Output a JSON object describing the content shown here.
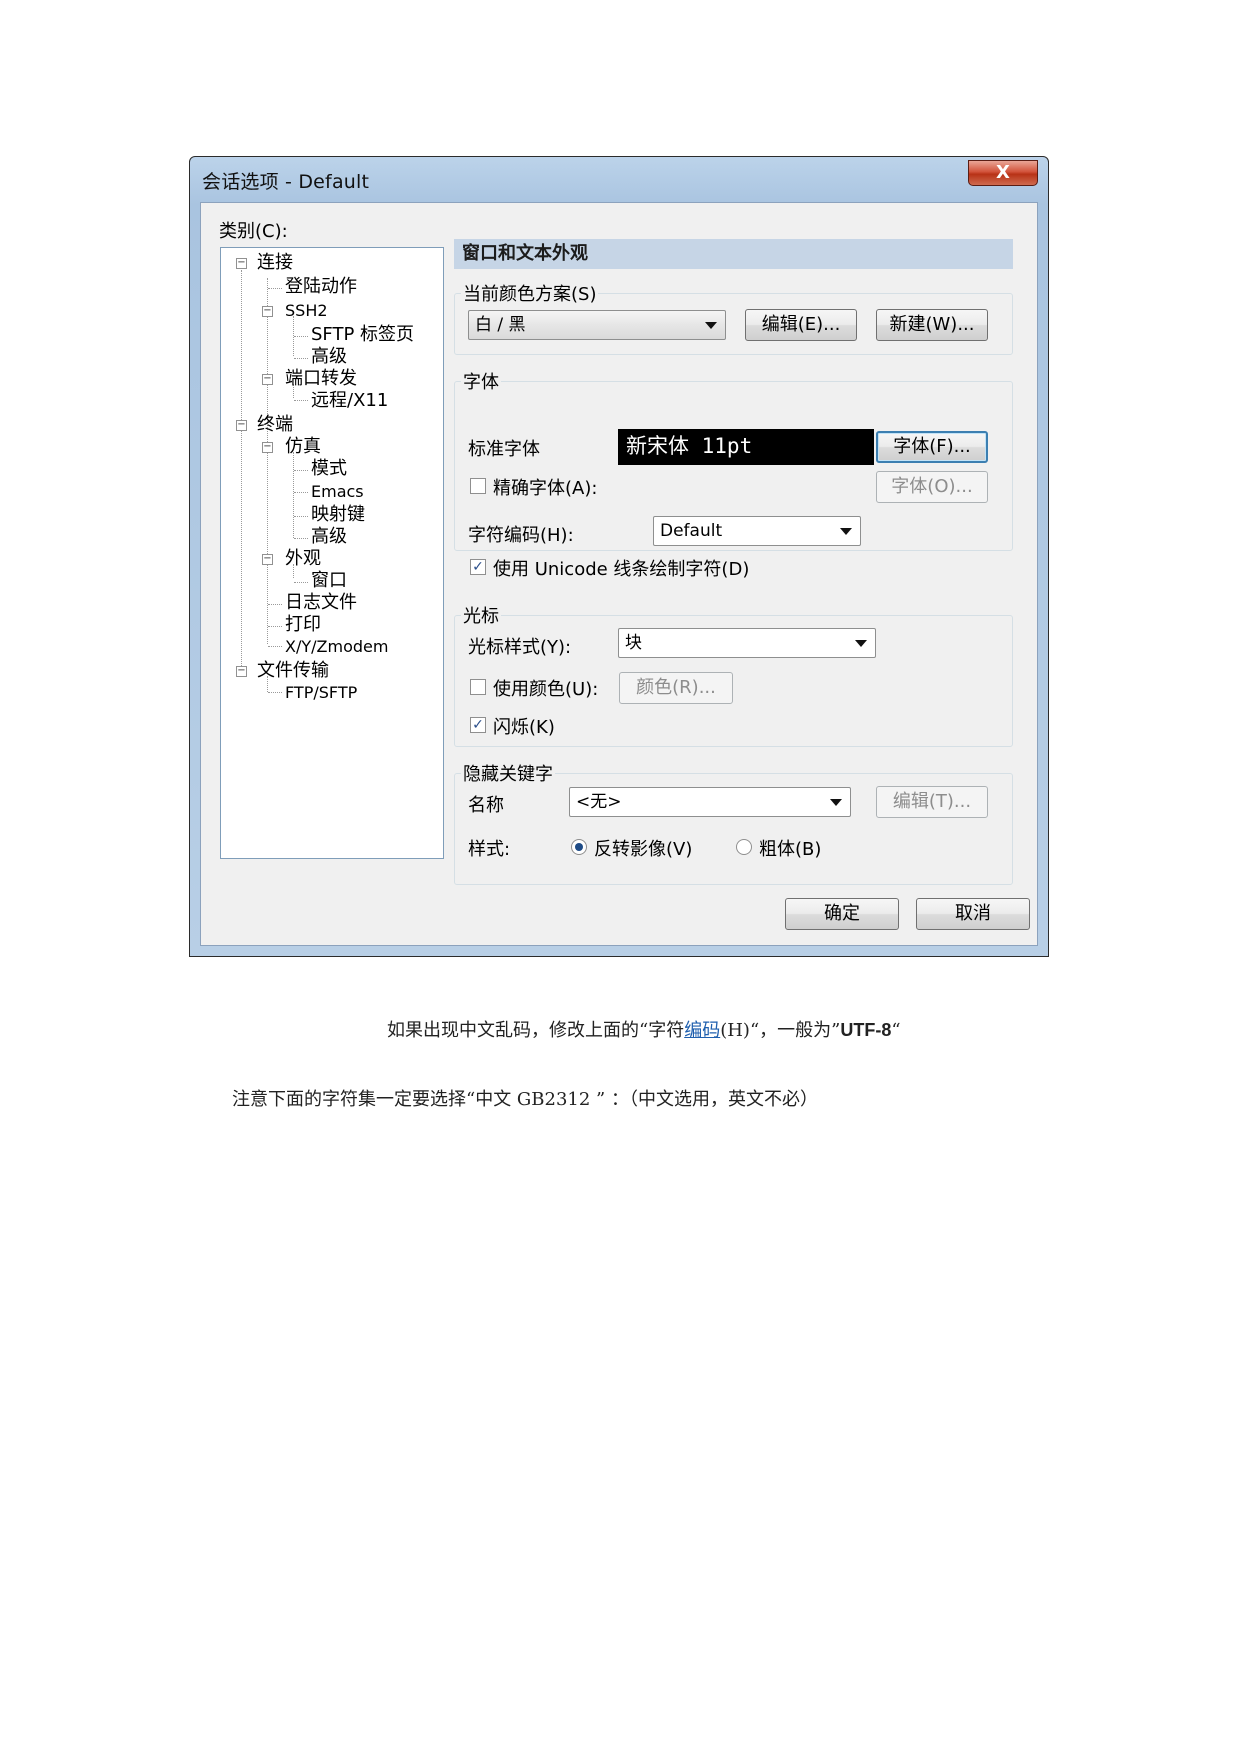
{
  "dialog": {
    "title": "会话选项 - Default",
    "close_label": "X",
    "category_label": "类别(C):",
    "tree": [
      {
        "label": "连接",
        "level": 0,
        "expanded": true
      },
      {
        "label": "登陆动作",
        "level": 1
      },
      {
        "label": "SSH2",
        "level": 1,
        "expanded": true
      },
      {
        "label": "SFTP 标签页",
        "level": 2
      },
      {
        "label": "高级",
        "level": 2
      },
      {
        "label": "端口转发",
        "level": 1,
        "expanded": true
      },
      {
        "label": "远程/X11",
        "level": 2
      },
      {
        "label": "终端",
        "level": 0,
        "expanded": true
      },
      {
        "label": "仿真",
        "level": 1,
        "expanded": true
      },
      {
        "label": "模式",
        "level": 2
      },
      {
        "label": "Emacs",
        "level": 2
      },
      {
        "label": "映射键",
        "level": 2
      },
      {
        "label": "高级",
        "level": 2
      },
      {
        "label": "外观",
        "level": 1,
        "expanded": true
      },
      {
        "label": "窗口",
        "level": 2
      },
      {
        "label": "日志文件",
        "level": 1
      },
      {
        "label": "打印",
        "level": 1
      },
      {
        "label": "X/Y/Zmodem",
        "level": 1
      },
      {
        "label": "文件传输",
        "level": 0,
        "expanded": true
      },
      {
        "label": "FTP/SFTP",
        "level": 1
      }
    ],
    "section_title": "窗口和文本外观",
    "color_scheme": {
      "group_label": "当前颜色方案(S)",
      "value": "白 / 黑",
      "edit_button": "编辑(E)...",
      "new_button": "新建(W)..."
    },
    "font": {
      "group_label": "字体",
      "standard_font_label": "标准字体",
      "preview": "新宋体 11pt",
      "font_button": "字体(F)...",
      "precise_font_label": "精确字体(A):",
      "precise_font_checked": false,
      "precise_font_button": "字体(O)...",
      "encoding_label": "字符编码(H):",
      "encoding_value": "Default",
      "unicode_label": "使用 Unicode 线条绘制字符(D)",
      "unicode_checked": true
    },
    "cursor": {
      "group_label": "光标",
      "style_label": "光标样式(Y):",
      "style_value": "块",
      "use_color_label": "使用颜色(U):",
      "use_color_checked": false,
      "color_button": "颜色(R)...",
      "blink_label": "闪烁(K)",
      "blink_checked": true
    },
    "keyword": {
      "group_label": "隐藏关键字",
      "name_label": "名称",
      "name_value": "<无>",
      "edit_button": "编辑(T)...",
      "style_label": "样式:",
      "reverse_label": "反转影像(V)",
      "bold_label": "粗体(B)",
      "selected": "reverse"
    },
    "ok_button": "确定",
    "cancel_button": "取消"
  },
  "text": {
    "line1_a": "如果出现中文乱码，修改上面的“字符",
    "line1_link": "编码",
    "line1_b": "(H)“，一般为”",
    "line1_bold": "UTF-8",
    "line1_c": "“",
    "line2": "注意下面的字符集一定要选择“中文  GB2312 ” ：（中文选用，英文不必）"
  },
  "colors": {
    "title_bar": "#b8cfe6",
    "close_button": "#c9432a",
    "section_header": "#c6d5e6",
    "link": "#1f5fae"
  }
}
